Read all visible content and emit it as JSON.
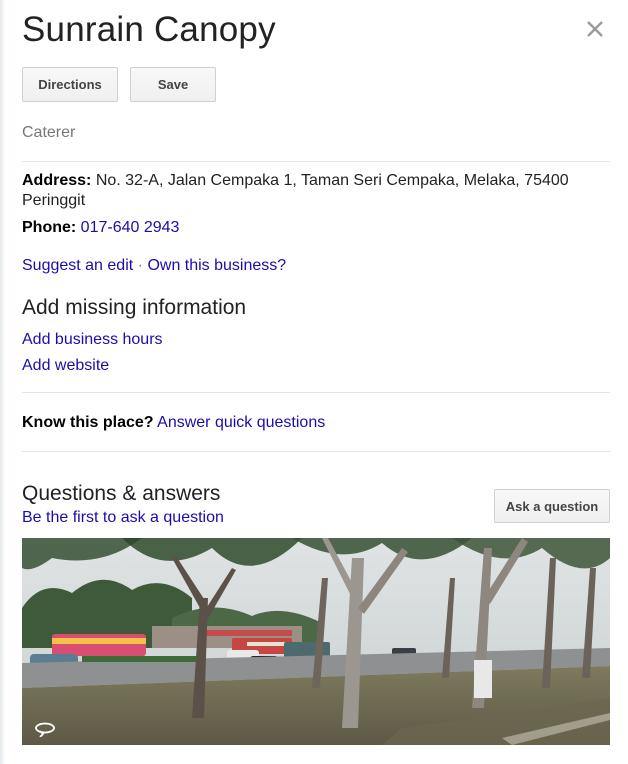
{
  "place": {
    "name": "Sunrain Canopy",
    "category": "Caterer"
  },
  "actions": {
    "directions_label": "Directions",
    "save_label": "Save"
  },
  "details": {
    "address_label": "Address:",
    "address_value": "No. 32-A, Jalan Cempaka 1, Taman Seri Cempaka, Melaka, 75400",
    "address_value_line2": "Peringgit",
    "phone_label": "Phone:",
    "phone_value": "017-640 2943"
  },
  "edit_links": {
    "suggest_edit": "Suggest an edit",
    "separator": "·",
    "own_business": "Own this business?"
  },
  "missing_info": {
    "heading": "Add missing information",
    "add_hours": "Add business hours",
    "add_website": "Add website"
  },
  "know_place": {
    "label": "Know this place?",
    "link": "Answer quick questions"
  },
  "qa": {
    "heading": "Questions & answers",
    "first_link": "Be the first to ask a question",
    "ask_button": "Ask a question"
  },
  "icons": {
    "close": "close-icon",
    "photo_type": "360-panorama-icon"
  },
  "colors": {
    "link": "#1a0dab",
    "text": "#222222",
    "muted": "#777777",
    "button_bg": "#f5f5f5",
    "divider": "#e6e6e6"
  }
}
